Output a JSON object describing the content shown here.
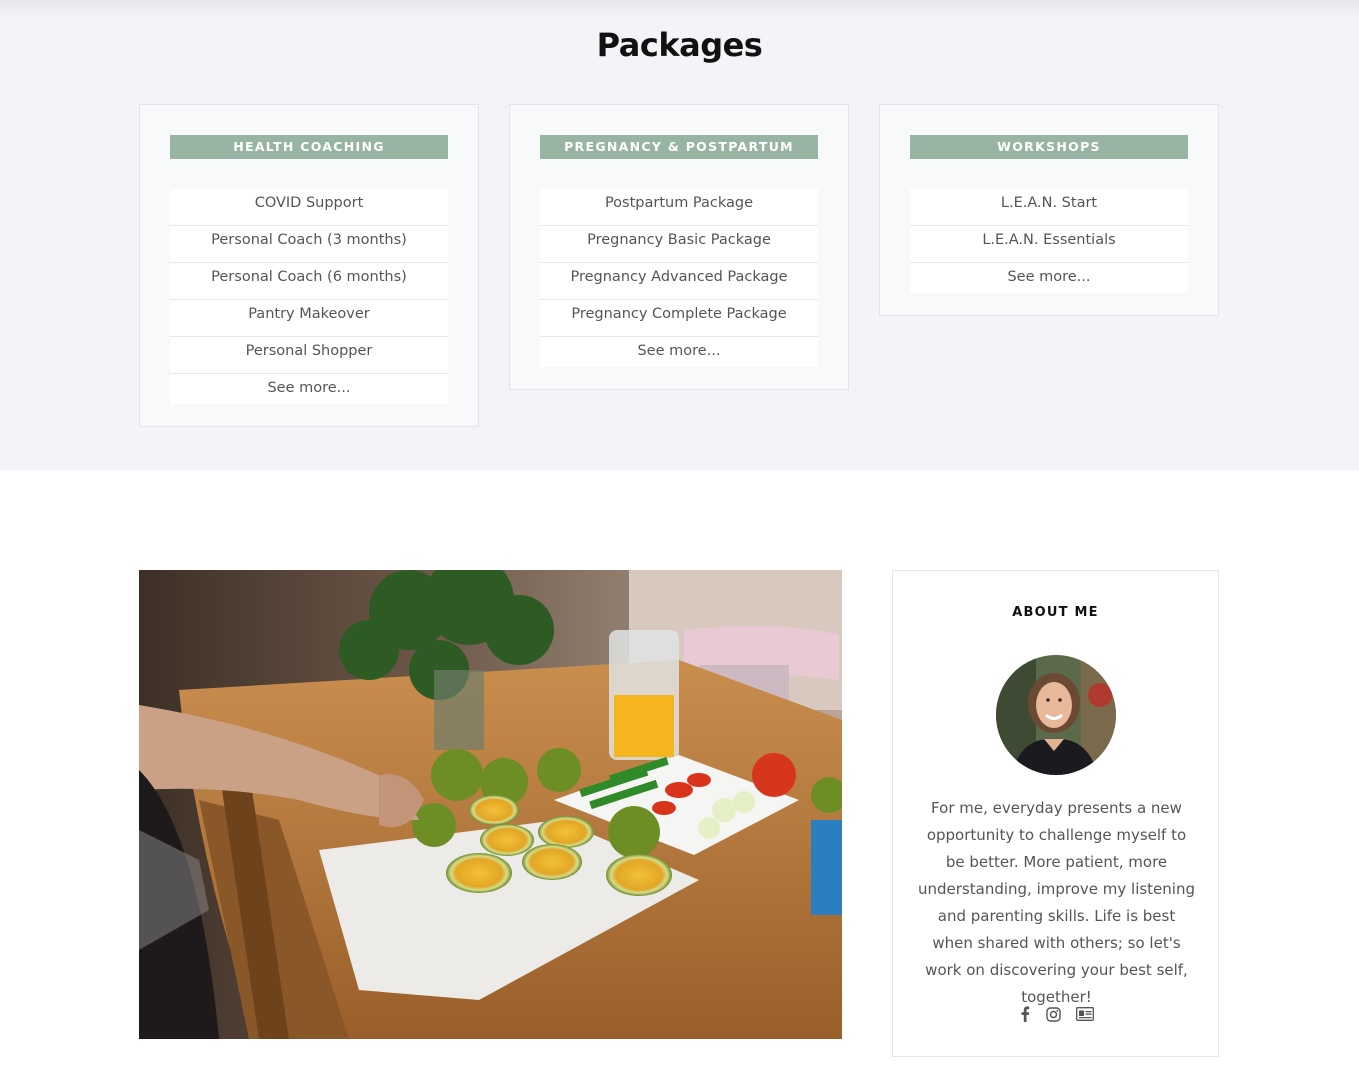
{
  "packages": {
    "title": "Packages",
    "cards": [
      {
        "header": "HEALTH COACHING",
        "items": [
          "COVID Support",
          "Personal Coach (3 months)",
          "Personal Coach (6 months)",
          "Pantry Makeover",
          "Personal Shopper",
          "See more..."
        ]
      },
      {
        "header": "PREGNANCY & POSTPARTUM",
        "items": [
          "Postpartum Package",
          "Pregnancy Basic Package",
          "Pregnancy Advanced Package",
          "Pregnancy Complete Package",
          "See more..."
        ]
      },
      {
        "header": "WORKSHOPS",
        "items": [
          "L.E.A.N. Start",
          "L.E.A.N. Essentials",
          "See more..."
        ]
      }
    ]
  },
  "about": {
    "title": "ABOUT ME",
    "text": "For me, everyday presents a new opportunity to challenge myself to be better. More patient, more understanding, improve my listening and parenting skills. Life is best when shared with others; so let's work on discovering your best self, together!",
    "social_icons": [
      "facebook-icon",
      "instagram-icon",
      "contact-card-icon"
    ]
  },
  "colors": {
    "accent": "#98b4a3",
    "section_bg": "#f3f4f7"
  }
}
